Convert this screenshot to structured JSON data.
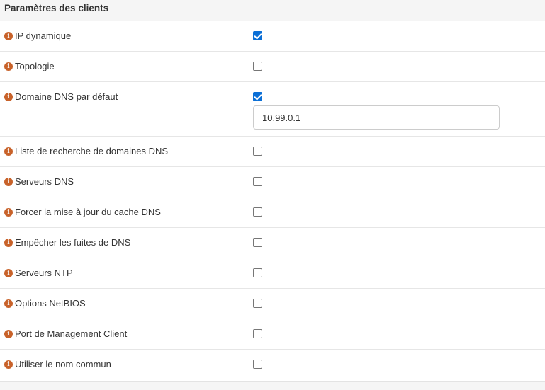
{
  "section": {
    "title": "Paramètres des clients"
  },
  "rows": [
    {
      "label": "IP dynamique",
      "checked": true
    },
    {
      "label": "Topologie",
      "checked": false
    },
    {
      "label": "Domaine DNS par défaut",
      "checked": true,
      "value": "10.99.0.1"
    },
    {
      "label": "Liste de recherche de domaines DNS",
      "checked": false
    },
    {
      "label": "Serveurs DNS",
      "checked": false
    },
    {
      "label": "Forcer la mise à jour du cache DNS",
      "checked": false
    },
    {
      "label": "Empêcher les fuites de DNS",
      "checked": false
    },
    {
      "label": "Serveurs NTP",
      "checked": false
    },
    {
      "label": "Options NetBIOS",
      "checked": false
    },
    {
      "label": "Port de Management Client",
      "checked": false
    },
    {
      "label": "Utiliser le nom commun",
      "checked": false
    }
  ],
  "icons": {
    "info": "info-icon",
    "info_glyph": "i"
  },
  "colors": {
    "info_icon": "#c8622a",
    "checkbox_checked": "#0b6fd6"
  }
}
